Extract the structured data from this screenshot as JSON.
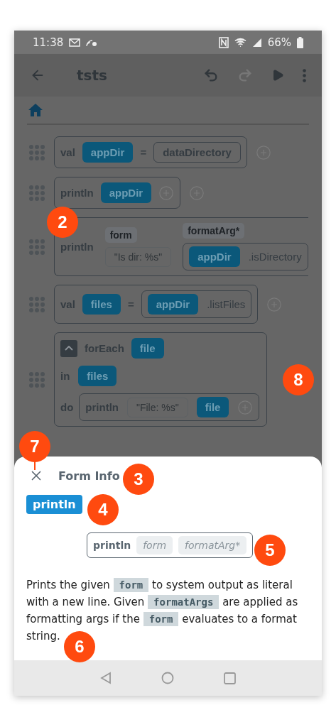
{
  "status_bar": {
    "time": "11:38",
    "battery": "66%"
  },
  "toolbar": {
    "title": "tsts",
    "undo_disabled": false,
    "redo_disabled": true
  },
  "statements": [
    {
      "kind": "assign",
      "keyword": "val",
      "name": "appDir",
      "op": "=",
      "value": {
        "kind": "ref",
        "text": "dataDirectory"
      }
    },
    {
      "kind": "call",
      "keyword": "println",
      "args": [
        {
          "kind": "var",
          "text": "appDir"
        }
      ]
    },
    {
      "kind": "call_params",
      "keyword": "println",
      "params": [
        {
          "label": "form",
          "value": {
            "kind": "string",
            "text": "\"Is dir: %s\""
          }
        },
        {
          "label": "formatArg*",
          "value": {
            "kind": "member",
            "target": "appDir",
            "member": ".isDirectory"
          }
        }
      ]
    },
    {
      "kind": "assign",
      "keyword": "val",
      "name": "files",
      "op": "=",
      "value": {
        "kind": "member",
        "target": "appDir",
        "member": ".listFiles"
      }
    },
    {
      "kind": "foreach",
      "keyword": "forEach",
      "var": "file",
      "expanded": true,
      "in_label": "in",
      "in_value": "files",
      "do_label": "do",
      "body": {
        "keyword": "println",
        "args": [
          {
            "kind": "string",
            "text": "\"File: %s\""
          },
          {
            "kind": "var",
            "text": "file"
          }
        ]
      }
    }
  ],
  "sheet": {
    "title": "Form Info",
    "form_name": "println",
    "signature": {
      "name": "println",
      "params": [
        "form",
        "formatArg*"
      ]
    },
    "description": [
      {
        "kind": "text",
        "text": "Prints the given "
      },
      {
        "kind": "code",
        "text": "form"
      },
      {
        "kind": "text",
        "text": " to system output as literal with a new line. Given "
      },
      {
        "kind": "code",
        "text": "formatArgs"
      },
      {
        "kind": "text",
        "text": " are applied as formatting args if the "
      },
      {
        "kind": "code",
        "text": "form"
      },
      {
        "kind": "text",
        "text": " evaluates to a format string."
      }
    ]
  },
  "annotations": [
    "2",
    "3",
    "4",
    "5",
    "6",
    "7",
    "8"
  ]
}
